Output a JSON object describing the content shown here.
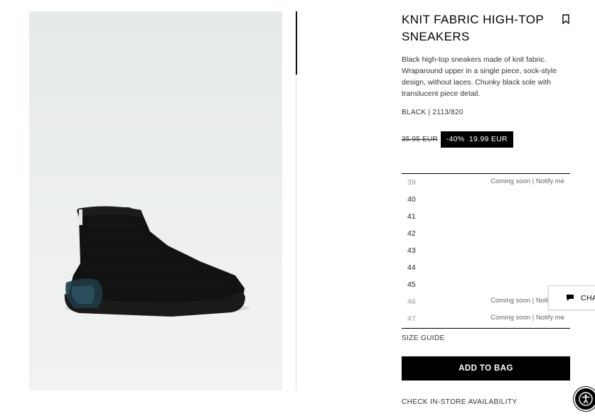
{
  "product": {
    "title": "KNIT FABRIC HIGH-TOP SNEAKERS",
    "description": "Black high-top sneakers made of knit fabric. Wraparound upper in a single piece, sock-style design, without laces. Chunky black sole with translucent piece detail.",
    "color_ref": "BLACK | 2113/820",
    "old_price": "35.95 EUR",
    "discount": "-40%",
    "sale_price": "19.99 EUR"
  },
  "sizes": [
    {
      "size": "39",
      "note": "Coming soon | Notify me",
      "available": false
    },
    {
      "size": "40",
      "note": "",
      "available": true
    },
    {
      "size": "41",
      "note": "",
      "available": true
    },
    {
      "size": "42",
      "note": "",
      "available": true
    },
    {
      "size": "43",
      "note": "",
      "available": true
    },
    {
      "size": "44",
      "note": "",
      "available": true
    },
    {
      "size": "45",
      "note": "",
      "available": true
    },
    {
      "size": "46",
      "note": "Coming soon | Notify me",
      "available": false
    },
    {
      "size": "47",
      "note": "Coming soon | Notify me",
      "available": false
    }
  ],
  "actions": {
    "size_guide": "SIZE GUIDE",
    "add_to_bag": "ADD TO BAG",
    "store_availability": "CHECK IN-STORE AVAILABILITY"
  },
  "chat": {
    "label": "CHAT"
  },
  "icons": {
    "bookmark": "bookmark-icon",
    "chat": "chat-bubble-icon",
    "accessibility": "accessibility-icon"
  },
  "colors": {
    "accent": "#000000",
    "background": "#ffffff",
    "photo_background": "#eceeed"
  }
}
